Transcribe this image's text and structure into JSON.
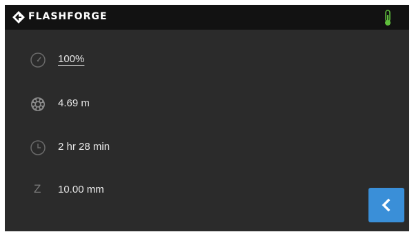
{
  "header": {
    "brand": "FLASHFORGE",
    "logo_icon": "flashforge-logo-icon",
    "status_icon": "thermometer-icon",
    "status_color": "#5fbf3c"
  },
  "stats": {
    "speed": {
      "icon": "speed-gauge-icon",
      "value": "100%"
    },
    "filament": {
      "icon": "filament-spool-icon",
      "value": "4.69 m"
    },
    "time": {
      "icon": "clock-icon",
      "value": "2 hr 28 min"
    },
    "z_height": {
      "label": "Z",
      "value": "10.00 mm"
    }
  },
  "actions": {
    "back_icon": "chevron-left-icon",
    "back_color": "#3a8fd8"
  }
}
